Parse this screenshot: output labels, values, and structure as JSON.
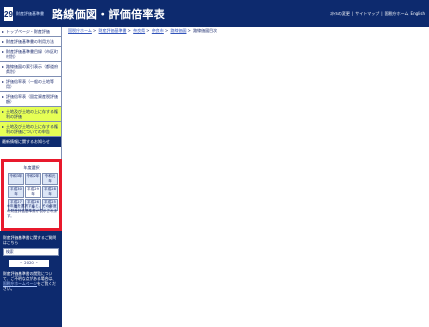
{
  "header": {
    "badge": "29",
    "sub_title": "財産評価基準書",
    "title": "路線価図・評価倍率表",
    "nav": [
      "ｽﾀｲﾙの変更",
      "|",
      "サイトマップ",
      "|",
      "国税庁ホーム",
      "English"
    ]
  },
  "sidebar": {
    "items": [
      {
        "label": "トップページ・財産評価"
      },
      {
        "label": "財産評価基準書の利用方法"
      },
      {
        "label": "財産評価基準書目録（市区町村別）"
      },
      {
        "label": "路線価図の索引表示（都道府県別）"
      },
      {
        "label": "評価倍率表（一般の土地等用）"
      },
      {
        "label": "評価倍率表（固定資産税評価額）"
      }
    ],
    "yellow_items": [
      {
        "label": "土地及び土地の上に存する権利の評価"
      },
      {
        "label": "土地及び土地の上に存する権利の評価についての申告"
      }
    ],
    "strip": "最新情報に関するお知らせ",
    "years": {
      "title": "年度選択",
      "items": [
        "令和3年",
        "令和2年",
        "令和元年",
        "平成30年",
        "平成29年",
        "平成28年",
        "平成27年",
        "平成26年",
        "平成25年"
      ],
      "note": "※年度を選択すると、その年度の財産評価基準書が表示されます。"
    },
    "info": {
      "text1": "財産評価基準書に関するご質問はこちら",
      "input_label": "検索",
      "select": "・ 2020 ・",
      "text2": "財産評価基準書の閲覧について、ご不明な点がある場合は、",
      "link": "国税庁ホームページ",
      "text3": "をご覧ください。"
    }
  },
  "breadcrumb": {
    "items": [
      "国税庁ホーム",
      "財産評価基準書",
      "奈良県",
      "奈良市",
      "路線価図"
    ],
    "current": "路線価図目次"
  }
}
